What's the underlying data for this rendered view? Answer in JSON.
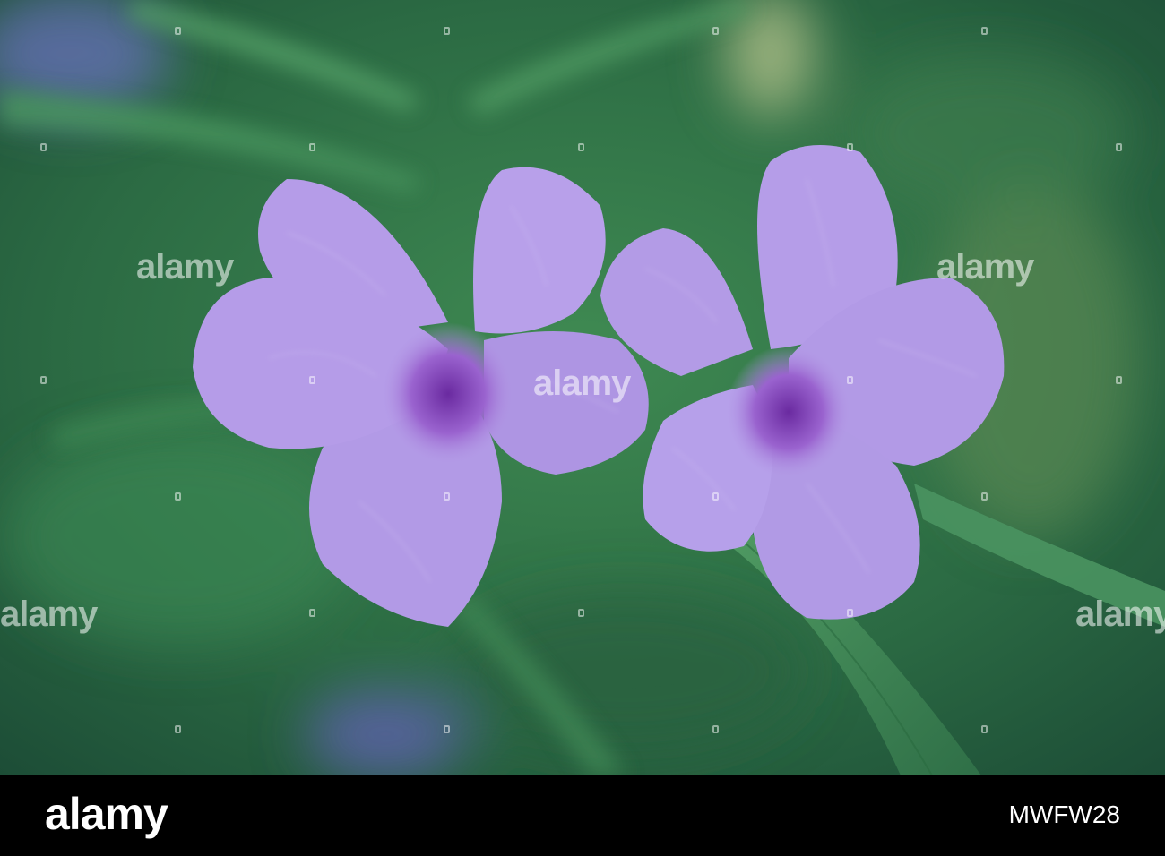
{
  "watermark": {
    "text": "alamy"
  },
  "footer": {
    "logo": "alamy",
    "image_id": "MWFW28"
  },
  "colors": {
    "background_green": "#2e6b40",
    "petal": "#b49ae6",
    "throat": "#7a3fb0",
    "footer": "#000000"
  }
}
